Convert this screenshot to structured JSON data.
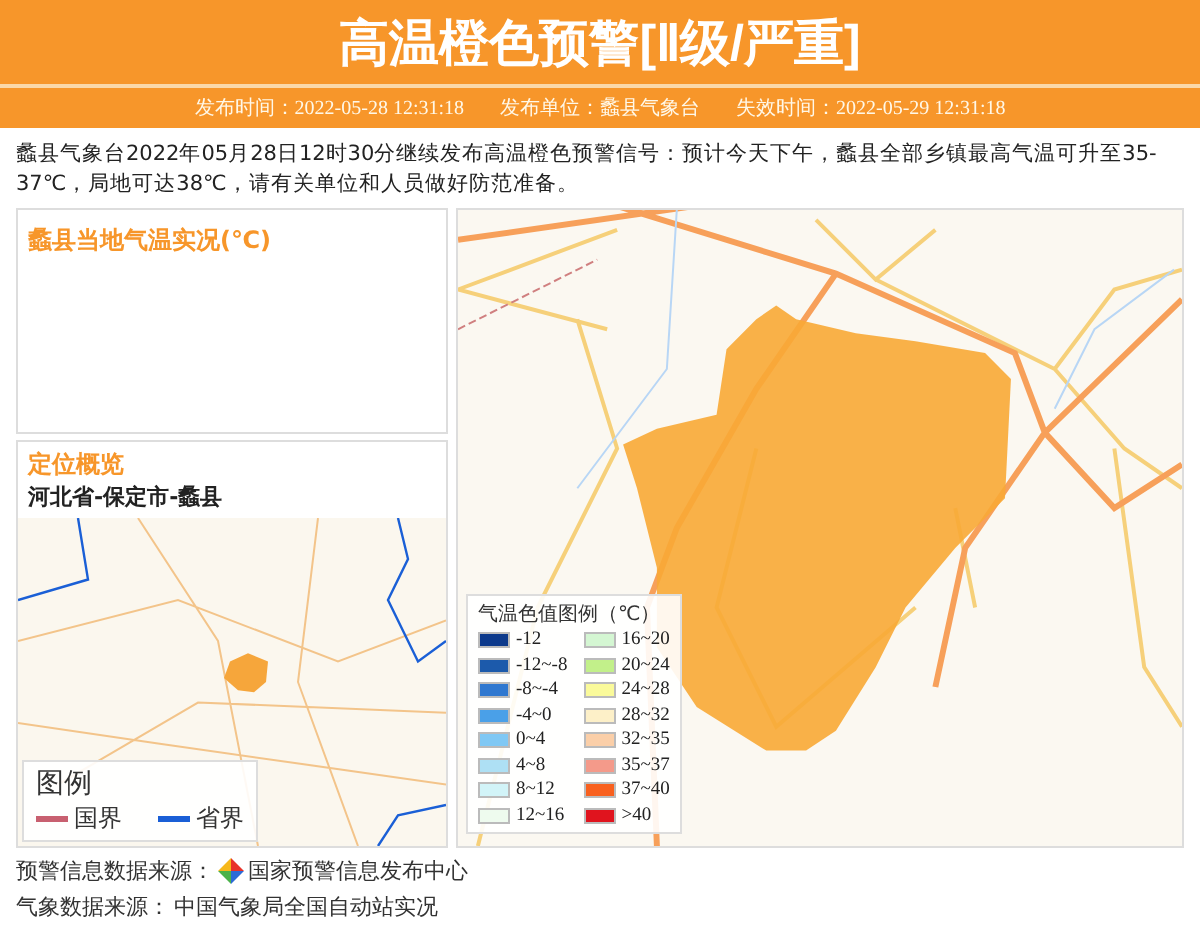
{
  "header": {
    "title": "高温橙色预警[Ⅱ级/严重]",
    "meta": [
      {
        "label": "发布时间：",
        "value": "2022-05-28 12:31:18"
      },
      {
        "label": "发布单位：",
        "value": "蠡县气象台"
      },
      {
        "label": "失效时间：",
        "value": "2022-05-29 12:31:18"
      }
    ]
  },
  "description": "蠡县气象台2022年05月28日12时30分继续发布高温橙色预警信号：预计今天下午，蠡县全部乡镇最高气温可升至35-37℃，局地可达38℃，请有关单位和人员做好防范准备。",
  "temperature_panel": {
    "title": "蠡县当地气温实况(℃)"
  },
  "location_panel": {
    "title": "定位概览",
    "location": "河北省-保定市-蠡县",
    "map_legend": {
      "title": "图例",
      "items": [
        {
          "label": "国界",
          "color": "#c86070"
        },
        {
          "label": "省界",
          "color": "#1a5fd6"
        }
      ]
    }
  },
  "temperature_legend": {
    "title": "气温色值图例（℃）",
    "items": [
      {
        "label": "-12",
        "color": "#0d3a8c"
      },
      {
        "label": "-12~-8",
        "color": "#1c5aab"
      },
      {
        "label": "-8~-4",
        "color": "#2f78d0"
      },
      {
        "label": "-4~0",
        "color": "#4aa0e8"
      },
      {
        "label": "0~4",
        "color": "#80c8f4"
      },
      {
        "label": "4~8",
        "color": "#aee0f4"
      },
      {
        "label": "8~12",
        "color": "#d2f4f8"
      },
      {
        "label": "12~16",
        "color": "#eefbee"
      },
      {
        "label": "16~20",
        "color": "#d4f6d2"
      },
      {
        "label": "20~24",
        "color": "#c2f08a"
      },
      {
        "label": "24~28",
        "color": "#fafa9a"
      },
      {
        "label": "28~32",
        "color": "#fdf0c8"
      },
      {
        "label": "32~35",
        "color": "#fbcfa8"
      },
      {
        "label": "35~37",
        "color": "#f49a8a"
      },
      {
        "label": "37~40",
        "color": "#f8601e"
      },
      {
        "label": ">40",
        "color": "#e0141e"
      }
    ]
  },
  "footer": [
    {
      "label": "预警信息数据来源：",
      "value": "国家预警信息发布中心",
      "logo": true
    },
    {
      "label": "气象数据来源：",
      "value": "中国气象局全国自动站实况",
      "logo": false
    }
  ]
}
